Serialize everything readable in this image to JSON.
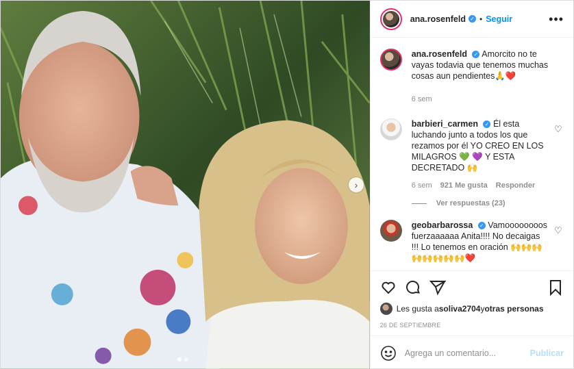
{
  "header": {
    "username": "ana.rosenfeld",
    "separator": "•",
    "follow_label": "Seguir",
    "more_label": "•••"
  },
  "caption": {
    "username": "ana.rosenfeld",
    "text": "Amorcito no te vayas todavia que tenemos muchas cosas aun pendientes🙏❤️",
    "time": "6 sem"
  },
  "comments": [
    {
      "username": "barbieri_carmen",
      "text": "Él esta luchando junto a todos los que rezamos por él YO CREO EN LOS MILAGROS 💚 💜 Y ESTA DECRETADO 🙌",
      "time": "6 sem",
      "likes": "921 Me gusta",
      "reply_label": "Responder",
      "view_replies": "Ver respuestas (23)"
    },
    {
      "username": "geobarbarossa",
      "text": "Vamoooooooos fuerzaaaaaa Anita!!!! No decaigas !!! Lo tenemos en oración 🙌🙌🙌🙌🙌🙌🙌🙌❤️"
    }
  ],
  "likes": {
    "prefix": "Les gusta a ",
    "user": "soliva2704",
    "middle": " y ",
    "others": "otras personas"
  },
  "date": "26 DE SEPTIEMBRE",
  "add_comment": {
    "placeholder": "Agrega un comentario...",
    "publish_label": "Publicar"
  },
  "media": {
    "next_arrow": "›",
    "slide_count": 2,
    "active_slide": 1
  },
  "colors": {
    "accent": "#0095f6",
    "verified": "#3897f0",
    "muted": "#8e8e8e",
    "publish_disabled": "#b2dffc"
  }
}
